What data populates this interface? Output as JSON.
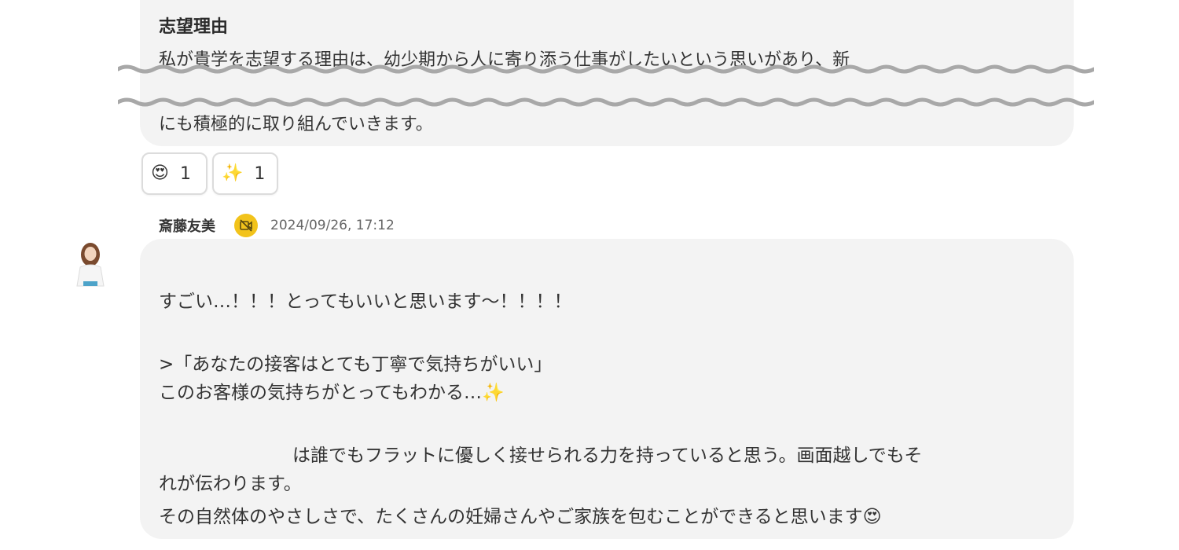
{
  "post": {
    "title": "志望理由",
    "line1": "私が貴学を志望する理由は、幼少期から人に寄り添う仕事がしたいという思いがあり、新",
    "line2": "にも積極的に取り組んでいきます。"
  },
  "reactions": [
    {
      "icon": "heart-eyes-icon",
      "emoji": "😍",
      "count": "1"
    },
    {
      "icon": "sparkles-icon",
      "emoji": "✨",
      "count": "1"
    }
  ],
  "comment": {
    "author": "斎藤友美",
    "timestamp": "2024/09/26, 17:12",
    "line1": "すごい…！！！とってもいいと思います〜！！！！",
    "line2": ">「あなたの接客はとても丁寧で気持ちがいい」",
    "line3": "このお客様の気持ちがとってもわかる…",
    "line3_emoji": "✨",
    "line4": "は誰でもフラットに優しく接せられる力を持っていると思う。画面越しでもそ",
    "line5": "れが伝わります。",
    "line6": "その自然体のやさしさで、たくさんの妊婦さんやご家族を包むことができると思います",
    "line6_emoji": "😍"
  },
  "colors": {
    "bubble": "#f3f3f3",
    "badge": "#f2c31b",
    "wave": "#a8a8a8"
  }
}
